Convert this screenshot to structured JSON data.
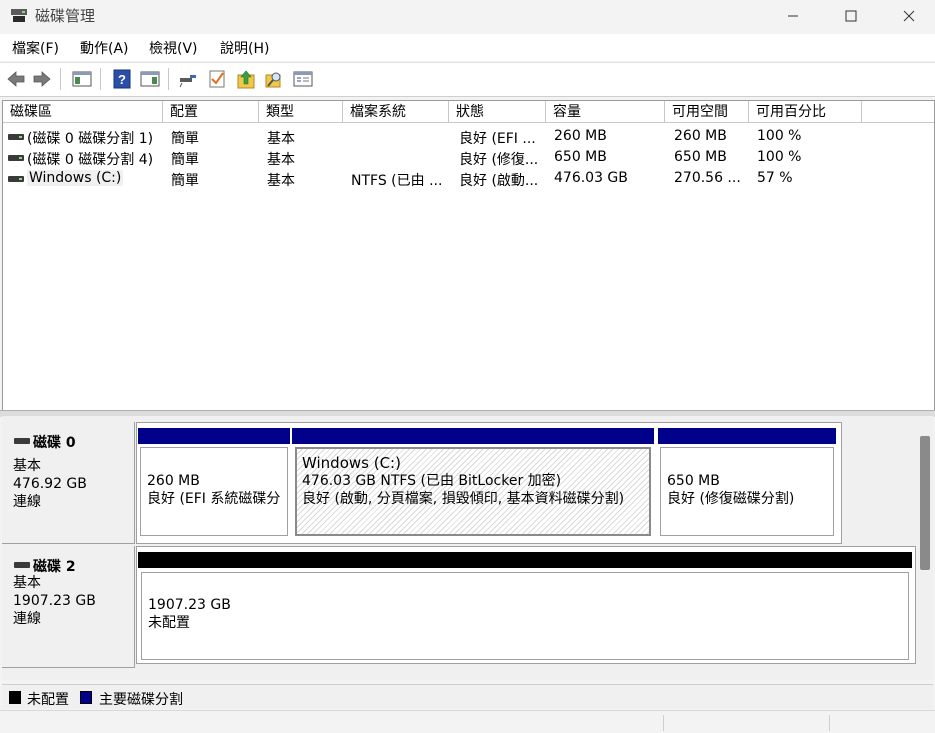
{
  "window": {
    "title": "磁碟管理"
  },
  "menu": [
    "檔案(F)",
    "動作(A)",
    "檢視(V)",
    "說明(H)"
  ],
  "toolbar": {
    "icons": [
      "back-arrow-icon",
      "forward-arrow-icon",
      "show-hide-console-tree-icon",
      "help-icon",
      "action-pane-icon",
      "connect-icon",
      "check-icon",
      "up-arrow-icon",
      "search-icon",
      "properties-icon"
    ]
  },
  "volume_list": {
    "columns": [
      "磁碟區",
      "配置",
      "類型",
      "檔案系統",
      "狀態",
      "容量",
      "可用空間",
      "可用百分比"
    ],
    "rows": [
      {
        "volume": "(磁碟 0 磁碟分割 1)",
        "layout": "簡單",
        "type": "基本",
        "fs": "",
        "status": "良好 (EFI ...",
        "capacity": "260 MB",
        "free": "260 MB",
        "pct": "100 %"
      },
      {
        "volume": "(磁碟 0 磁碟分割 4)",
        "layout": "簡單",
        "type": "基本",
        "fs": "",
        "status": "良好 (修復...",
        "capacity": "650 MB",
        "free": "650 MB",
        "pct": "100 %"
      },
      {
        "volume": "Windows (C:)",
        "layout": "簡單",
        "type": "基本",
        "fs": "NTFS (已由 ...",
        "status": "良好 (啟動...",
        "capacity": "476.03 GB",
        "free": "270.56 ...",
        "pct": "57 %"
      }
    ]
  },
  "disks": [
    {
      "name": "磁碟 0",
      "kind": "基本",
      "size": "476.92 GB",
      "state": "連線",
      "partitions": [
        {
          "title": "",
          "line1": "260 MB",
          "line2": "良好 (EFI 系統磁碟分",
          "color": "#00008b"
        },
        {
          "title": "Windows  (C:)",
          "line1": "476.03 GB NTFS (已由 BitLocker 加密)",
          "line2": "良好 (啟動, 分頁檔案, 損毀傾印, 基本資料磁碟分割)",
          "color": "#00008b"
        },
        {
          "title": "",
          "line1": "650 MB",
          "line2": "良好 (修復磁碟分割)",
          "color": "#00008b"
        }
      ]
    },
    {
      "name": "磁碟 2",
      "kind": "基本",
      "size": "1907.23 GB",
      "state": "連線",
      "partitions": [
        {
          "title": "",
          "line1": "1907.23 GB",
          "line2": "未配置",
          "color": "#000000"
        }
      ]
    }
  ],
  "legend": [
    {
      "label": "未配置",
      "color": "#000000"
    },
    {
      "label": "主要磁碟分割",
      "color": "#00008b"
    }
  ]
}
